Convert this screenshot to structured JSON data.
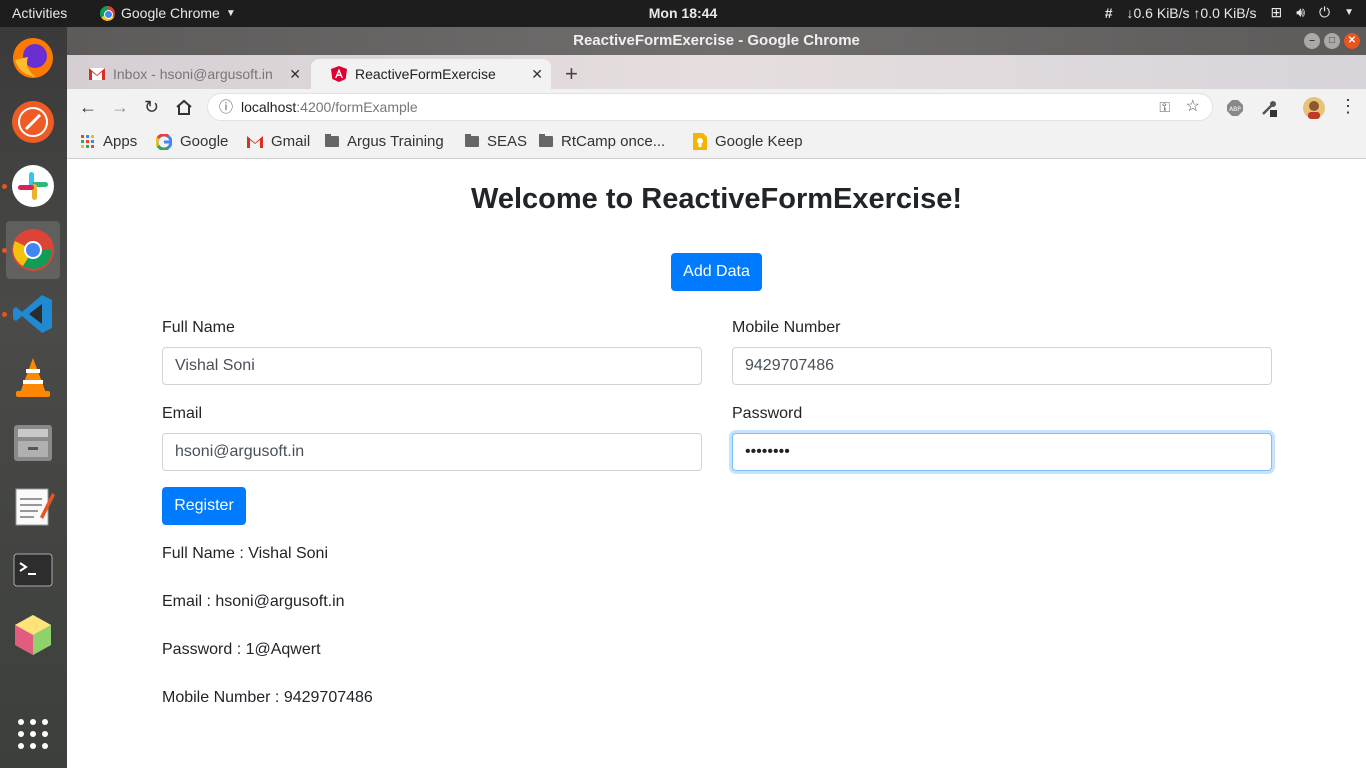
{
  "topbar": {
    "activities": "Activities",
    "app_name": "Google Chrome",
    "clock": "Mon 18:44",
    "network_speed": "↓0.6 KiB/s ↑0.0 KiB/s"
  },
  "window": {
    "title": "ReactiveFormExercise - Google Chrome"
  },
  "tabs": [
    {
      "title": "Inbox - hsoni@argusoft.in"
    },
    {
      "title": "ReactiveFormExercise"
    }
  ],
  "omnibox": {
    "host": "localhost",
    "path": ":4200/formExample"
  },
  "bookmarks": {
    "apps": "Apps",
    "google": "Google",
    "gmail": "Gmail",
    "argus": "Argus Training",
    "seas": "SEAS",
    "rtcamp": "RtCamp once...",
    "keep": "Google Keep"
  },
  "page": {
    "heading": "Welcome to ReactiveFormExercise!",
    "add_data": "Add Data",
    "form": {
      "full_name_label": "Full Name",
      "full_name_value": "Vishal Soni",
      "mobile_label": "Mobile Number",
      "mobile_value": "9429707486",
      "email_label": "Email",
      "email_value": "hsoni@argusoft.in",
      "password_label": "Password",
      "password_value": "••••••••"
    },
    "register": "Register",
    "output": {
      "full_name": "Full Name : Vishal Soni",
      "email": "Email : hsoni@argusoft.in",
      "password": "Password : 1@Aqwert",
      "mobile": "Mobile Number : 9429707486"
    }
  },
  "colors": {
    "primary": "#007bff",
    "ubuntu_orange": "#e95420"
  }
}
